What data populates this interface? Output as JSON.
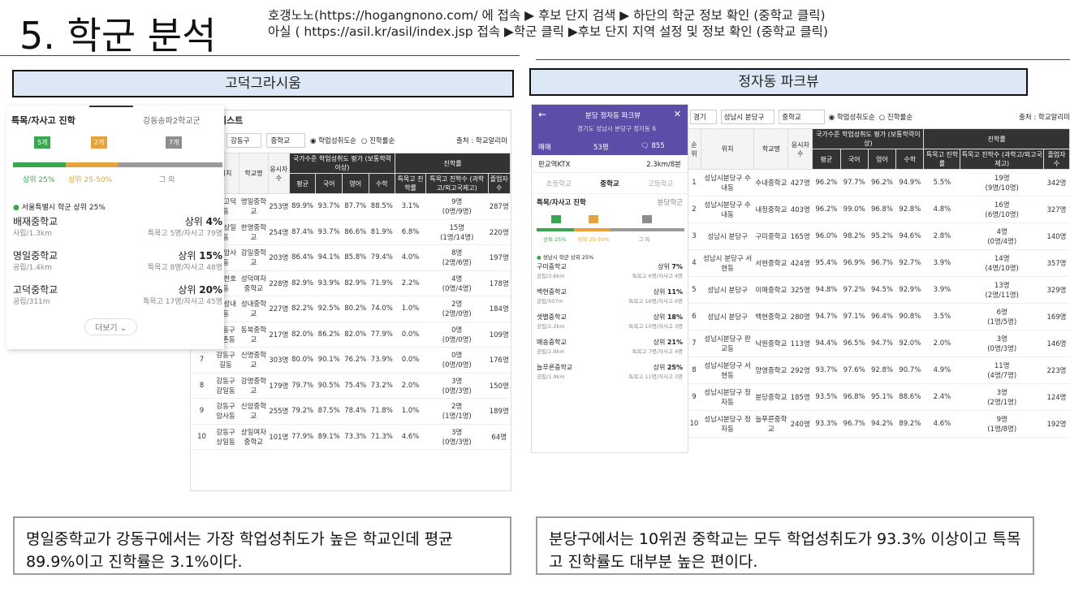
{
  "title": "5. 학군 분석",
  "header": {
    "line1_pre": "호갱노노(",
    "line1_link": "https://hogangnono.com/",
    "line1_post": " 에 접속 ▶ 후보 단지 검색 ▶ 하단의 학군 정보 확인 (중학교 클릭)",
    "line2_pre": "아실 ( ",
    "line2_link": "https://asil.kr/asil/index.jsp",
    "line2_post": " 접속 ▶학군 클릭 ▶후보 단지 지역 설정 및 정보 확인 (중학교 클릭)"
  },
  "left": {
    "box": "고덕그라시움",
    "panel": {
      "title": "특목/자사고 진학",
      "region": "강동송파2학교군",
      "count1": "5개",
      "count2": "2개",
      "count3": "7개",
      "leg1": "상위 25%",
      "leg2": "상위 25-50%",
      "leg3": "그 외",
      "note": "서울특별시 학군 상위 25%",
      "schools": [
        {
          "name": "배재중학교",
          "rank_pre": "상위 ",
          "rank": "4%",
          "sub": "사립/1.3km",
          "info": "특목고 5명/자사고 79명"
        },
        {
          "name": "명일중학교",
          "rank_pre": "상위 ",
          "rank": "15%",
          "sub": "공립/1.4km",
          "info": "특목고 8명/자사고 48명"
        },
        {
          "name": "고덕중학교",
          "rank_pre": "상위 ",
          "rank": "20%",
          "sub": "공립/311m",
          "info": "특목고 17명/자사고 45명"
        }
      ],
      "more": "더보기"
    },
    "list_title": "리스트",
    "sel1": "강동구",
    "sel2": "중학교",
    "radio1": "학업성취도순",
    "radio2": "진학률순",
    "source": "출처 : 학교알리미",
    "heads": [
      "위치",
      "학교명",
      "응시자수",
      "국가수준 학업성취도 평가 (보통학력이상)",
      "진학률",
      "평균",
      "국어",
      "영어",
      "수학",
      "특목고 진학률",
      "특목고 진학수 (과학고/외고국제고)",
      "졸업자 수"
    ],
    "rows": [
      [
        "",
        "구 고덕동",
        "명일중학교",
        "253명",
        "89.9%",
        "93.7%",
        "87.7%",
        "88.5%",
        "3.1%",
        "9명",
        "(0명/9명)",
        "287명"
      ],
      [
        "",
        "구 상일동",
        "한영중학교",
        "254명",
        "87.4%",
        "93.7%",
        "86.6%",
        "81.9%",
        "6.8%",
        "15명",
        "(1명/14명)",
        "220명"
      ],
      [
        "",
        "구 암사동",
        "강일중학교",
        "203명",
        "86.4%",
        "94.1%",
        "85.8%",
        "79.4%",
        "4.0%",
        "8명",
        "(2명/6명)",
        "197명"
      ],
      [
        "",
        "구 천호동",
        "성덕여자중학교",
        "228명",
        "82.9%",
        "93.9%",
        "82.9%",
        "71.9%",
        "2.2%",
        "4명",
        "(0명/4명)",
        "178명"
      ],
      [
        "",
        "구 성내동",
        "성내중학교",
        "227명",
        "82.2%",
        "92.5%",
        "80.2%",
        "74.0%",
        "1.0%",
        "2명",
        "(2명/0명)",
        "184명"
      ],
      [
        "6",
        "강동구 둔촌동",
        "동북중학교",
        "217명",
        "82.0%",
        "86.2%",
        "82.0%",
        "77.9%",
        "0.0%",
        "0명",
        "(0명/0명)",
        "109명"
      ],
      [
        "7",
        "강동구 길동",
        "신명중학교",
        "303명",
        "80.0%",
        "90.1%",
        "76.2%",
        "73.9%",
        "0.0%",
        "0명",
        "(0명/0명)",
        "176명"
      ],
      [
        "8",
        "강동구 강일동",
        "강명중학교",
        "179명",
        "79.7%",
        "90.5%",
        "75.4%",
        "73.2%",
        "2.0%",
        "3명",
        "(0명/3명)",
        "150명"
      ],
      [
        "9",
        "강동구 암사동",
        "신암중학교",
        "255명",
        "79.2%",
        "87.5%",
        "78.4%",
        "71.8%",
        "1.0%",
        "2명",
        "(1명/1명)",
        "189명"
      ],
      [
        "10",
        "강동구 상일동",
        "상일여자중학교",
        "101명",
        "77.9%",
        "89.1%",
        "73.3%",
        "71.3%",
        "4.6%",
        "3명",
        "(0명/3명)",
        "64명"
      ]
    ]
  },
  "right": {
    "box": "정자동 파크뷰",
    "panel": {
      "back": "←",
      "title": "분당 정자동 파크뷰",
      "addr": "경기도 성남시 분당구 정자동 6",
      "trade": "매매",
      "size": "53평",
      "chat": "855",
      "station": "판교역KTX",
      "dist": "2.3km/8분",
      "tab1": "초등학교",
      "tab2": "중학교",
      "tab3": "고등학교",
      "sec": "특목/자사고 진학",
      "region": "분당학군",
      "note": "성남시 학군 상위 25%",
      "leg1": "상위 25%",
      "leg2": "상위 25-50%",
      "leg3": "그 외",
      "schools": [
        {
          "name": "구미중학교",
          "rank_pre": "상위 ",
          "rank": "7%",
          "sub": "공립/3.6km",
          "info": "특목고 6명/자사고 4명"
        },
        {
          "name": "백현중학교",
          "rank_pre": "상위 ",
          "rank": "11%",
          "sub": "공립/507m",
          "info": "특목고 16명/자사고 6명"
        },
        {
          "name": "샛별중학교",
          "rank_pre": "상위 ",
          "rank": "18%",
          "sub": "공립/2.2km",
          "info": "특목고 10명/자사고 3명"
        },
        {
          "name": "매송중학교",
          "rank_pre": "상위 ",
          "rank": "21%",
          "sub": "공립/2.9km",
          "info": "특목고 7명/자사고 4명"
        },
        {
          "name": "늘푸른중학교",
          "rank_pre": "상위 ",
          "rank": "25%",
          "sub": "공립/1.9km",
          "info": "특목고 11명/자사고 3명"
        }
      ]
    },
    "sel0": "경기",
    "sel1": "성남시 분당구",
    "sel2": "중학교",
    "radio1": "학업성취도순",
    "radio2": "진학률순",
    "source": "출처 : 학교알리미",
    "heads": [
      "순위",
      "위치",
      "학교명",
      "응시자수",
      "국가수준 학업성취도 평가 (보통학력이상)",
      "진학률",
      "평균",
      "국어",
      "영어",
      "수학",
      "특목고 진학률",
      "특목고 진학수 (과학고/외고국제고)",
      "졸업자 수"
    ],
    "rows": [
      [
        "1",
        "성남시분당구 수내동",
        "수내중학교",
        "427명",
        "96.2%",
        "97.7%",
        "96.2%",
        "94.9%",
        "5.5%",
        "19명",
        "(9명/10명)",
        "342명"
      ],
      [
        "2",
        "성남시분당구 수내동",
        "내정중학교",
        "403명",
        "96.2%",
        "99.0%",
        "96.8%",
        "92.8%",
        "4.8%",
        "16명",
        "(6명/10명)",
        "327명"
      ],
      [
        "3",
        "성남시 분당구",
        "구미중학교",
        "165명",
        "96.0%",
        "98.2%",
        "95.2%",
        "94.6%",
        "2.8%",
        "4명",
        "(0명/4명)",
        "140명"
      ],
      [
        "4",
        "성남시 분당구 서현동",
        "서현중학교",
        "424명",
        "95.4%",
        "96.9%",
        "96.7%",
        "92.7%",
        "3.9%",
        "14명",
        "(4명/10명)",
        "357명"
      ],
      [
        "5",
        "성남시 분당구",
        "이매중학교",
        "325명",
        "94.8%",
        "97.2%",
        "94.5%",
        "92.9%",
        "3.9%",
        "13명",
        "(2명/11명)",
        "329명"
      ],
      [
        "6",
        "성남시 분당구",
        "백현중학교",
        "280명",
        "94.7%",
        "97.1%",
        "96.4%",
        "90.8%",
        "3.5%",
        "6명",
        "(1명/5명)",
        "169명"
      ],
      [
        "7",
        "성남시분당구 판교동",
        "낙원중학교",
        "113명",
        "94.4%",
        "96.5%",
        "94.7%",
        "92.0%",
        "2.0%",
        "3명",
        "(0명/3명)",
        "146명"
      ],
      [
        "8",
        "성남시분당구 서현동",
        "양영중학교",
        "292명",
        "93.7%",
        "97.6%",
        "92.8%",
        "90.7%",
        "4.9%",
        "11명",
        "(4명/7명)",
        "223명"
      ],
      [
        "9",
        "성남시분당구 정자동",
        "분당중학교",
        "185명",
        "93.5%",
        "96.8%",
        "95.1%",
        "88.6%",
        "2.4%",
        "3명",
        "(2명/1명)",
        "124명"
      ],
      [
        "10",
        "성남시분당구 정자동",
        "늘푸른중학교",
        "240명",
        "93.3%",
        "96.7%",
        "94.2%",
        "89.2%",
        "4.6%",
        "9명",
        "(1명/8명)",
        "192명"
      ]
    ]
  },
  "bottom_left": "명일중학교가 강동구에서는 가장 학업성취도가 높은 학교인데 평균 89.9%이고 진학률은 3.1%이다.",
  "bottom_right": "분당구에서는 10위권 중학교는 모두 학업성취도가 93.3% 이상이고 특목고 진학률도 대부분 높은 편이다.",
  "colors": {
    "green": "#3aa651",
    "orange": "#e6a23c",
    "gray": "#8d8d8d",
    "purple": "#5b4ea8",
    "accent": "#1f5fd6"
  }
}
